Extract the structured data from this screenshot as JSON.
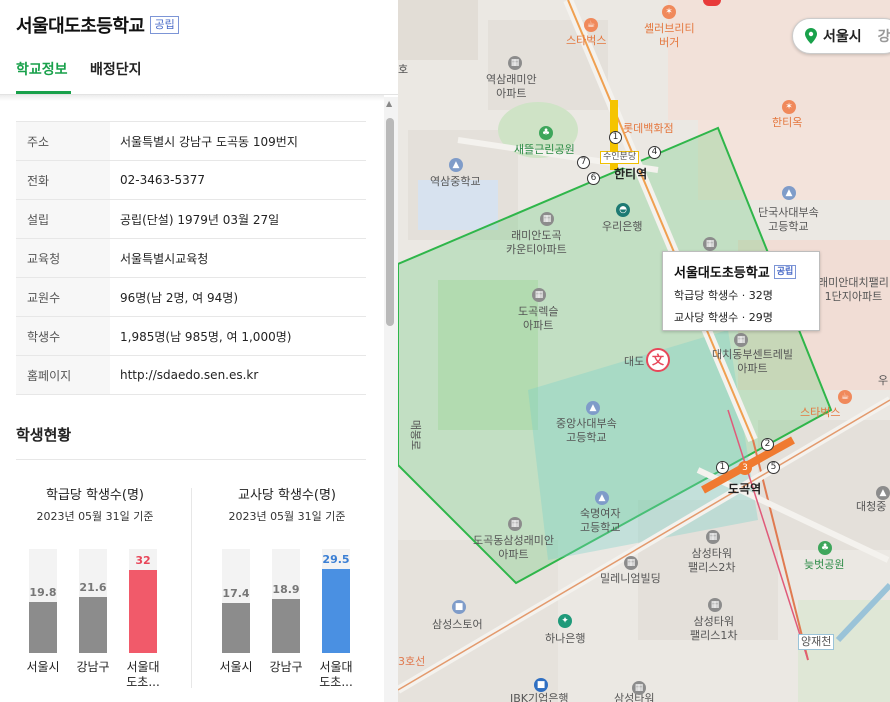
{
  "school": {
    "name": "서울대도초등학교",
    "type_badge": "공립"
  },
  "tabs": [
    {
      "label": "학교정보",
      "active": true
    },
    {
      "label": "배정단지",
      "active": false
    }
  ],
  "info": [
    {
      "key": "주소",
      "value": "서울특별시 강남구 도곡동 109번지"
    },
    {
      "key": "전화",
      "value": "02-3463-5377"
    },
    {
      "key": "설립",
      "value": "공립(단설) 1979년 03월 27일"
    },
    {
      "key": "교육청",
      "value": "서울특별시교육청"
    },
    {
      "key": "교원수",
      "value": "96명(남 2명, 여 94명)"
    },
    {
      "key": "학생수",
      "value": "1,985명(남 985명, 여 1,000명)"
    },
    {
      "key": "홈페이지",
      "value": "http://sdaedo.sen.es.kr"
    }
  ],
  "section_title": "학생현황",
  "chart_data": [
    {
      "type": "bar",
      "title": "학급당 학생수(명)",
      "subtitle": "2023년 05월 31일 기준",
      "categories": [
        "서울시",
        "강남구",
        "서울대도초..."
      ],
      "values": [
        19.8,
        21.6,
        32
      ],
      "ylim": [
        0,
        40
      ],
      "colors": [
        "#8c8c8c",
        "#8c8c8c",
        "#f15a6a"
      ],
      "value_colors": [
        "#777777",
        "#777777",
        "#e8475a"
      ]
    },
    {
      "type": "bar",
      "title": "교사당 학생수(명)",
      "subtitle": "2023년 05월 31일 기준",
      "categories": [
        "서울시",
        "강남구",
        "서울대도초..."
      ],
      "values": [
        17.4,
        18.9,
        29.5
      ],
      "ylim": [
        0,
        36.5
      ],
      "colors": [
        "#8c8c8c",
        "#8c8c8c",
        "#4a90e2"
      ],
      "value_colors": [
        "#777777",
        "#777777",
        "#3b7fd4"
      ]
    }
  ],
  "map": {
    "region_button": "서울시",
    "region_button_overflow": "강",
    "tooltip": {
      "name": "서울대도초등학교",
      "badge": "공립",
      "line1": "학급당 학생수 · 32명",
      "line2": "교사당 학생수 · 29명"
    },
    "labels": {
      "starbucks1": "스타벅스",
      "shelbrete": "셸러브리티\n버거",
      "yeoksam_apt": "역삼래미안\n아파트",
      "lotte": "롯데백화점",
      "saetteul": "새뜰근린공원",
      "yeoksam_ms": "역삼중학교",
      "hanti": "한티역",
      "hantiok": "한티옥",
      "dankook": "단국사대부속\n고등학교",
      "raemian_caventia": "래미안도곡\n카운티아파트",
      "woori": "우리은행",
      "raemian_daechi": "래미안대치팰리\n1단지아파트",
      "dogok_rexle": "도곡렉슬\n아파트",
      "daechi_center": "대치동부센트레빌\n아파트",
      "school_pin_label": "대도   교",
      "starbucks2": "스타벅스",
      "joongang": "중앙사대부속\n고등학교",
      "dogok_station": "도곡역",
      "sookmyung": "숙명여자\n고등학교",
      "daecheong": "대청중",
      "dogok_samsung": "도곡동삼성래미안\n아파트",
      "samsung_tower2": "삼성타워\n팰리스2차",
      "neutbat": "늦벗공원",
      "millennium": "밀레니엄빌딩",
      "samsung_store": "삼성스토어",
      "hana": "하나은행",
      "samsung_tower1": "삼성타워\n팰리스1차",
      "yangjae": "양재천",
      "road_3": "3호선",
      "rodong_road": "매봉로",
      "ibk": "IBK기업은행",
      "ho": "호",
      "samsung_tower_bottom": "삼성타워",
      "u_char": "우",
      "suinbundang": "수인분당"
    }
  }
}
